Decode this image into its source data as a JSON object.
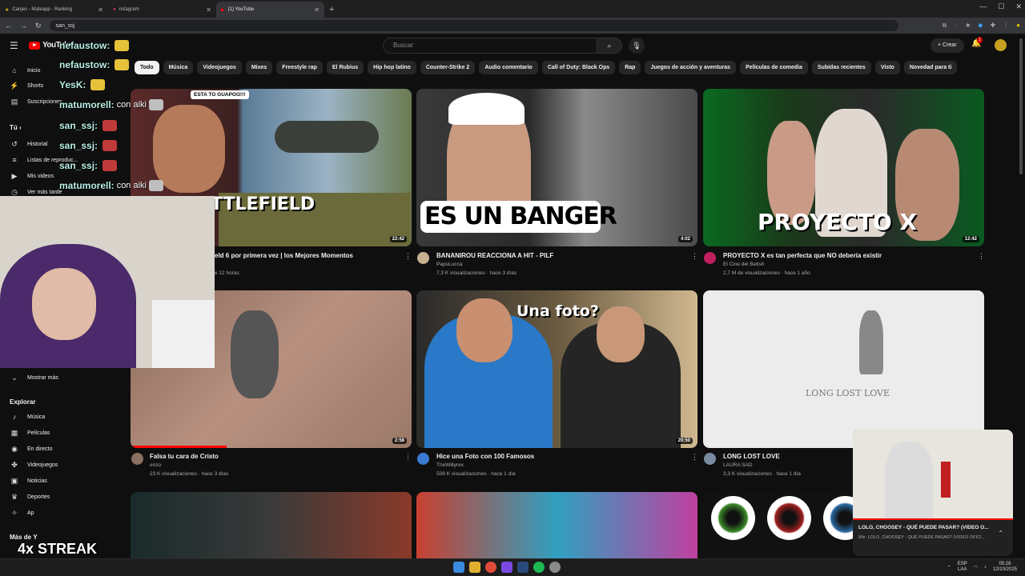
{
  "browser": {
    "tabs": [
      {
        "title": "Canjes - Mateapp - Ranking"
      },
      {
        "title": "nstagram"
      },
      {
        "title": "(1) YouTube"
      }
    ],
    "omni_text": "san_ssj"
  },
  "header": {
    "logo": "YouTube",
    "search_placeholder": "Buscar",
    "crear": "+ Crear",
    "notifications": "1"
  },
  "chips": [
    "Todo",
    "Música",
    "Videojuegos",
    "Mixes",
    "Freestyle rap",
    "El Rubius",
    "Hip hop latino",
    "Counter-Strike 2",
    "Audio comentario",
    "Call of Duty: Black Ops",
    "Rap",
    "Juegos de acción y aventuras",
    "Películas de comedia",
    "Subidas recientes",
    "Visto",
    "Novedad para ti"
  ],
  "sidebar": {
    "main": [
      "Inicio",
      "Shorts",
      "Suscripciones"
    ],
    "you_header": "Tú",
    "you": [
      "Historial",
      "Listas de reproduc...",
      "Mis videos",
      "Ver más tarde"
    ],
    "show_more": "Mostrar más",
    "explore_header": "Explorar",
    "explore": [
      "Música",
      "Películas",
      "En directo",
      "Videojuegos",
      "Noticias",
      "Deportes",
      "Ap"
    ],
    "more_header": "Más de Y"
  },
  "videos": [
    {
      "title": "eld 6 por primera vez | los Mejores Momentos",
      "channel": "",
      "meta": "e 12 horas",
      "duration": "22:42",
      "overlay": "TTLEFIELD",
      "tag": "ESTA TO GUAPOO!!!"
    },
    {
      "title": "BANANIROU REACCIONA A HIT - PILF",
      "channel": "PapuLucca",
      "meta": "7,3 K visualizaciones · hace 3 días",
      "duration": "4:02",
      "overlay": "ES UN BANGER"
    },
    {
      "title": "PROYECTO X es tan perfecta que NO debería existir",
      "channel": "El Cine del Betish",
      "meta": "2,7 M de visualizaciones · hace 1 año",
      "duration": "12:42",
      "overlay": "PROYECTO X"
    },
    {
      "title": "Falsa tu cara de Cristo",
      "channel": "enzo",
      "meta": "23 K visualizaciones · hace 3 días",
      "duration": "2:58",
      "overlay": ""
    },
    {
      "title": "Hice una Foto con 100 Famosos",
      "channel": "TheWillyrex",
      "meta": "508 K visualizaciones · hace 1 día",
      "duration": "20:50",
      "overlay": "Una foto?"
    },
    {
      "title": "LONG LOST LOVE",
      "channel": "LAURA SAD",
      "meta": "3,3 K visualizaciones · hace 1 día",
      "duration": "",
      "overlay": "LONG LOST LOVE"
    }
  ],
  "chat": [
    {
      "name": "nefaustow:",
      "msg": ""
    },
    {
      "name": "nefaustow:",
      "msg": ""
    },
    {
      "name": "YesK:",
      "msg": ""
    },
    {
      "name": "matumorell:",
      "msg": "con aiki"
    },
    {
      "name": "san_ssj:",
      "msg": ""
    },
    {
      "name": "san_ssj:",
      "msg": ""
    },
    {
      "name": "san_ssj:",
      "msg": ""
    },
    {
      "name": "matumorell:",
      "msg": "con aiki"
    }
  ],
  "streak": "4x STREAK",
  "miniplayer": {
    "title": "LOLO, CHOOSEY - QUÉ PUEDE PASAR? (VIDEO O...",
    "subtitle": "Mix: LOLO, CHOOSEY - QUÉ PUEDE PASAR? (VIDEO OFICI..."
  },
  "taskbar": {
    "lang1": "ESP",
    "lang2": "LAA",
    "time": "05:28",
    "date": "12/10/2025"
  },
  "colors": {
    "accent": "#ff0000",
    "chat_name": "#b9f0e6",
    "bg": "#0f0f0f"
  }
}
